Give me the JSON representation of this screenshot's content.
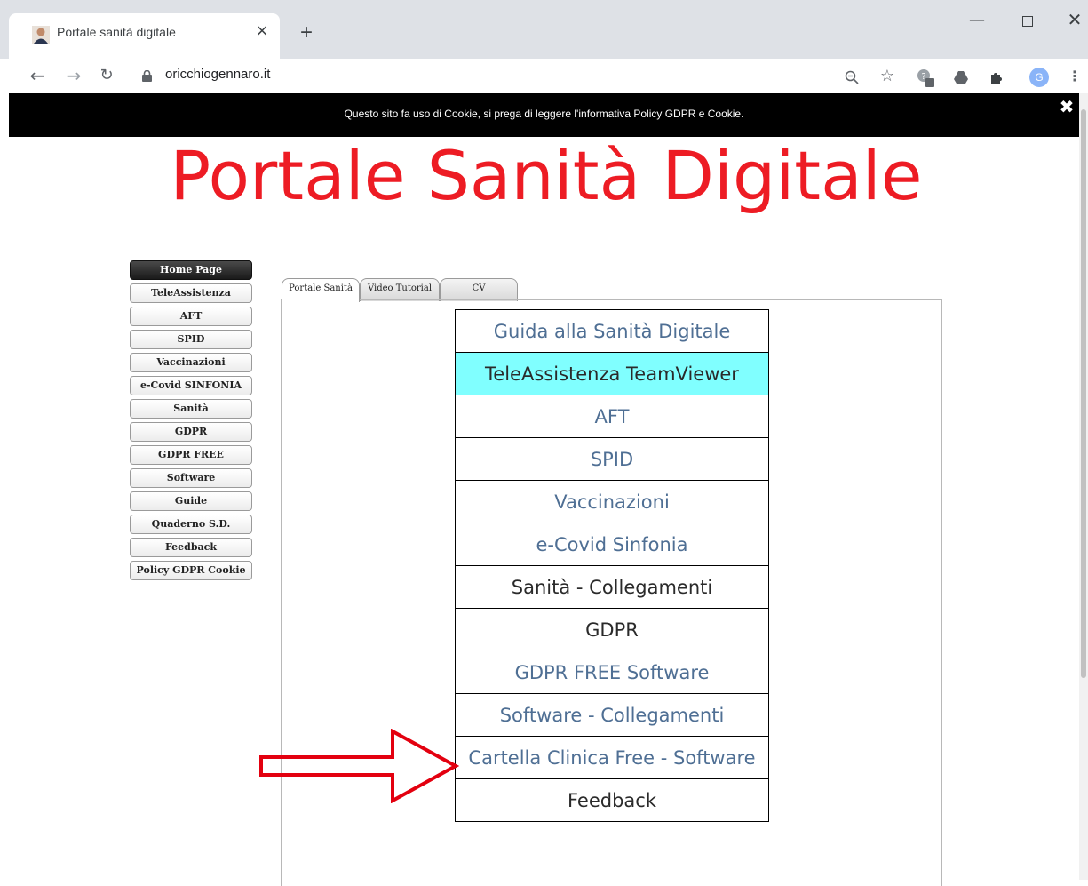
{
  "browser": {
    "tab_title": "Portale sanità digitale",
    "tab_close": "×",
    "new_tab": "+",
    "url": "oricchiogennaro.it",
    "avatar_letter": "G",
    "extension_badge": "0"
  },
  "cookie_banner": {
    "text": "Questo sito fa uso di Cookie, si prega di leggere l'informativa Policy GDPR e Cookie.",
    "close": "✖"
  },
  "site_title": "Portale Sanità Digitale",
  "side_menu": [
    {
      "label": "Home Page",
      "active": true
    },
    {
      "label": "TeleAssistenza"
    },
    {
      "label": "AFT"
    },
    {
      "label": "SPID"
    },
    {
      "label": "Vaccinazioni"
    },
    {
      "label": "e-Covid SINFONIA"
    },
    {
      "label": "Sanità"
    },
    {
      "label": "GDPR"
    },
    {
      "label": "GDPR FREE"
    },
    {
      "label": "Software"
    },
    {
      "label": "Guide"
    },
    {
      "label": "Quaderno S.D."
    },
    {
      "label": "Feedback"
    },
    {
      "label": "Policy GDPR Cookie"
    }
  ],
  "panel_tabs": [
    {
      "label": "Portale Sanità",
      "active": true
    },
    {
      "label": "Video Tutorial"
    },
    {
      "label": "CV"
    }
  ],
  "links": [
    {
      "label": "Guida alla Sanità Digitale",
      "style": "blue"
    },
    {
      "label": "TeleAssistenza TeamViewer",
      "style": "hl"
    },
    {
      "label": "AFT",
      "style": "blue"
    },
    {
      "label": "SPID",
      "style": "blue"
    },
    {
      "label": "Vaccinazioni",
      "style": "blue"
    },
    {
      "label": "e-Covid Sinfonia",
      "style": "blue"
    },
    {
      "label": "Sanità - Collegamenti",
      "style": "dark"
    },
    {
      "label": "GDPR",
      "style": "dark"
    },
    {
      "label": "GDPR FREE Software",
      "style": "blue"
    },
    {
      "label": "Software - Collegamenti",
      "style": "blue"
    },
    {
      "label": "Cartella Clinica Free - Software",
      "style": "blue"
    },
    {
      "label": "Feedback",
      "style": "dark"
    }
  ],
  "colors": {
    "title_red": "#ed1c24",
    "highlight_cyan": "#80ffff",
    "link_blue": "#4f6f94",
    "arrow_red": "#e3000f"
  }
}
